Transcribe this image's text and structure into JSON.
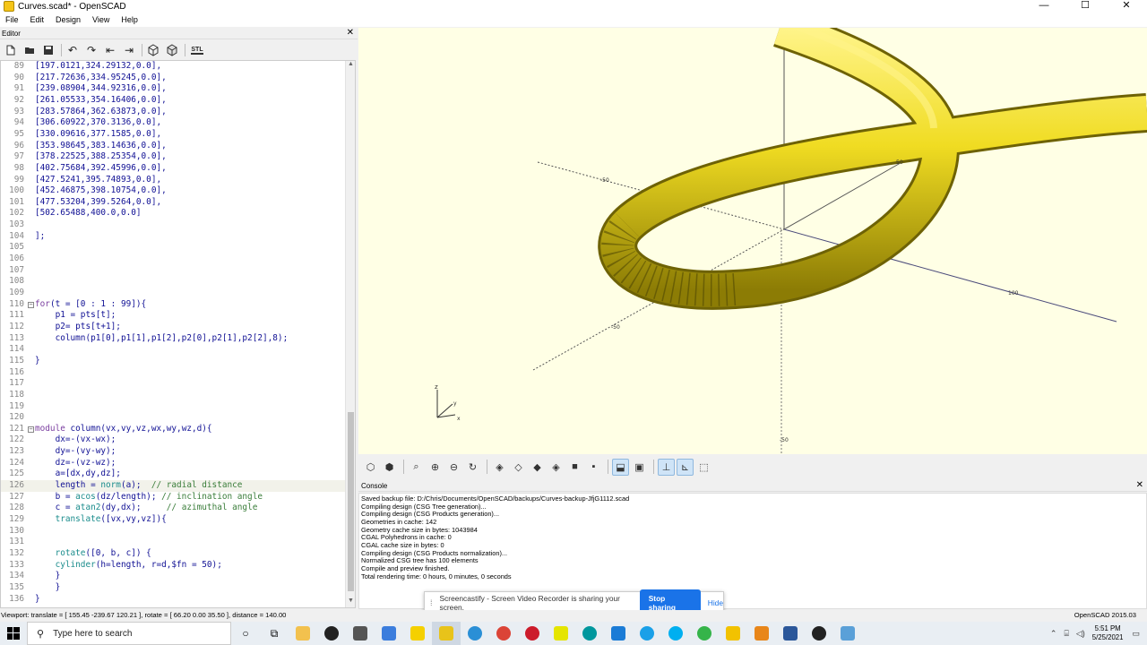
{
  "window": {
    "title": "Curves.scad* - OpenSCAD",
    "minimize": "—",
    "maximize": "☐",
    "close": "✕"
  },
  "menu": [
    "File",
    "Edit",
    "Design",
    "View",
    "Help"
  ],
  "editor": {
    "header": "Editor",
    "close": "✕",
    "toolbar_icons": [
      "new-icon",
      "open-icon",
      "save-icon",
      "undo-icon",
      "redo-icon",
      "unindent-icon",
      "indent-icon",
      "preview-icon",
      "render-icon",
      "export-stl-icon"
    ],
    "stl_label": "STL",
    "lines": [
      {
        "n": "89",
        "t": "[197.0121,324.29132,0.0],"
      },
      {
        "n": "90",
        "t": "[217.72636,334.95245,0.0],"
      },
      {
        "n": "91",
        "t": "[239.08904,344.92316,0.0],"
      },
      {
        "n": "92",
        "t": "[261.05533,354.16406,0.0],"
      },
      {
        "n": "93",
        "t": "[283.57864,362.63873,0.0],"
      },
      {
        "n": "94",
        "t": "[306.60922,370.3136,0.0],"
      },
      {
        "n": "95",
        "t": "[330.09616,377.1585,0.0],"
      },
      {
        "n": "96",
        "t": "[353.98645,383.14636,0.0],"
      },
      {
        "n": "97",
        "t": "[378.22525,388.25354,0.0],"
      },
      {
        "n": "98",
        "t": "[402.75684,392.45996,0.0],"
      },
      {
        "n": "99",
        "t": "[427.5241,395.74893,0.0],"
      },
      {
        "n": "100",
        "t": "[452.46875,398.10754,0.0],"
      },
      {
        "n": "101",
        "t": "[477.53204,399.5264,0.0],"
      },
      {
        "n": "102",
        "t": "[502.65488,400.0,0.0]"
      },
      {
        "n": "103",
        "t": ""
      },
      {
        "n": "104",
        "t": "];"
      },
      {
        "n": "105",
        "t": ""
      },
      {
        "n": "106",
        "t": ""
      },
      {
        "n": "107",
        "t": ""
      },
      {
        "n": "108",
        "t": ""
      },
      {
        "n": "109",
        "t": ""
      },
      {
        "n": "110",
        "t": "for(t = [0 : 1 : 99]){"
      },
      {
        "n": "111",
        "t": "    p1 = pts[t];"
      },
      {
        "n": "112",
        "t": "    p2= pts[t+1];"
      },
      {
        "n": "113",
        "t": "    column(p1[0],p1[1],p1[2],p2[0],p2[1],p2[2],8);"
      },
      {
        "n": "114",
        "t": ""
      },
      {
        "n": "115",
        "t": "}"
      },
      {
        "n": "116",
        "t": ""
      },
      {
        "n": "117",
        "t": ""
      },
      {
        "n": "118",
        "t": ""
      },
      {
        "n": "119",
        "t": ""
      },
      {
        "n": "120",
        "t": ""
      },
      {
        "n": "121",
        "t": "module column(vx,vy,vz,wx,wy,wz,d){"
      },
      {
        "n": "122",
        "t": "    dx=-(vx-wx);"
      },
      {
        "n": "123",
        "t": "    dy=-(vy-wy);"
      },
      {
        "n": "124",
        "t": "    dz=-(vz-wz);"
      },
      {
        "n": "125",
        "t": "    a=[dx,dy,dz];"
      },
      {
        "n": "126",
        "t": "    length = norm(a);  // radial distance"
      },
      {
        "n": "127",
        "t": "    b = acos(dz/length); // inclination angle"
      },
      {
        "n": "128",
        "t": "    c = atan2(dy,dx);     // azimuthal angle"
      },
      {
        "n": "129",
        "t": "    translate([vx,vy,vz]){"
      },
      {
        "n": "130",
        "t": ""
      },
      {
        "n": "131",
        "t": ""
      },
      {
        "n": "132",
        "t": "    rotate([0, b, c]) {"
      },
      {
        "n": "133",
        "t": "    cylinder(h=length, r=d,$fn = 50);"
      },
      {
        "n": "134",
        "t": "    }"
      },
      {
        "n": "135",
        "t": "    }"
      },
      {
        "n": "136",
        "t": "}"
      }
    ],
    "colors": {
      "code": "#101094",
      "comment": "#3a7d3a",
      "keyword": "#7b3fa0",
      "function": "#1a8c8c"
    }
  },
  "viewport": {
    "background": "#ffffe5",
    "model_color": "#e8d21a",
    "axis_labels": [
      "z",
      "y",
      "x"
    ]
  },
  "view_toolbar": {
    "icons": [
      "preview-icon",
      "render-icon",
      "view-all-icon",
      "zoom-in-icon",
      "zoom-out-icon",
      "reset-view-icon",
      "view-right-icon",
      "view-top-icon",
      "view-bottom-icon",
      "view-left-icon",
      "view-front-icon",
      "view-back-icon",
      "perspective-icon",
      "orthogonal-icon",
      "show-axes-icon",
      "show-scale-icon",
      "show-edges-icon"
    ]
  },
  "console": {
    "header": "Console",
    "close": "✕",
    "lines": [
      "Saved backup file: D:/Chris/Documents/OpenSCAD/backups/Curves-backup-JfjG1112.scad",
      "Compiling design (CSG Tree generation)...",
      "Compiling design (CSG Products generation)...",
      "Geometries in cache: 142",
      "Geometry cache size in bytes: 1043984",
      "CGAL Polyhedrons in cache: 0",
      "CGAL cache size in bytes: 0",
      "Compiling design (CSG Products normalization)...",
      "Normalized CSG tree has 100 elements",
      "Compile and preview finished.",
      "Total rendering time: 0 hours, 0 minutes, 0 seconds"
    ]
  },
  "share_bar": {
    "message": "Screencastify - Screen Video Recorder is sharing your screen.",
    "stop": "Stop sharing",
    "hide": "Hide"
  },
  "status": {
    "viewport": "Viewport: translate = [ 155.45 -239.67 120.21 ], rotate = [ 66.20 0.00 35.50 ], distance = 140.00",
    "version": "OpenSCAD 2015.03"
  },
  "taskbar": {
    "search_placeholder": "Type here to search",
    "time": "5:51 PM",
    "date": "5/25/2021"
  }
}
